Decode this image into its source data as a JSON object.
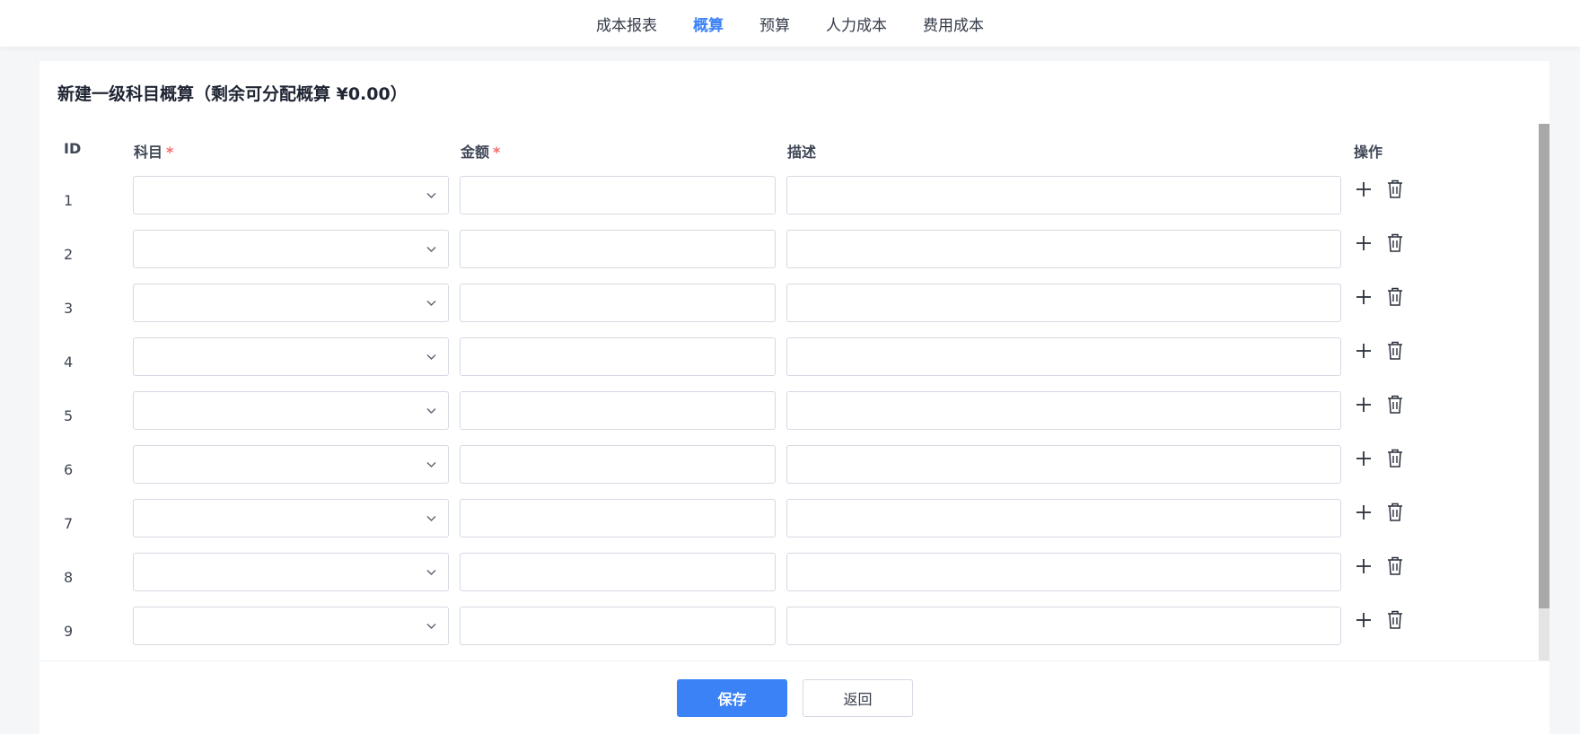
{
  "nav": {
    "tabs": [
      {
        "label": "成本报表",
        "active": false
      },
      {
        "label": "概算",
        "active": true
      },
      {
        "label": "预算",
        "active": false
      },
      {
        "label": "人力成本",
        "active": false
      },
      {
        "label": "费用成本",
        "active": false
      }
    ]
  },
  "form": {
    "title": "新建一级科目概算（剩余可分配概算 ¥0.00）",
    "columns": {
      "id": "ID",
      "subject": "科目",
      "amount": "金额",
      "description": "描述",
      "actions": "操作",
      "required_mark": "*"
    },
    "rows": [
      {
        "id": "1",
        "subject": "",
        "amount": "",
        "description": ""
      },
      {
        "id": "2",
        "subject": "",
        "amount": "",
        "description": ""
      },
      {
        "id": "3",
        "subject": "",
        "amount": "",
        "description": ""
      },
      {
        "id": "4",
        "subject": "",
        "amount": "",
        "description": ""
      },
      {
        "id": "5",
        "subject": "",
        "amount": "",
        "description": ""
      },
      {
        "id": "6",
        "subject": "",
        "amount": "",
        "description": ""
      },
      {
        "id": "7",
        "subject": "",
        "amount": "",
        "description": ""
      },
      {
        "id": "8",
        "subject": "",
        "amount": "",
        "description": ""
      },
      {
        "id": "9",
        "subject": "",
        "amount": "",
        "description": ""
      },
      {
        "id": "",
        "subject": "",
        "amount": "",
        "description": ""
      }
    ],
    "icons": {
      "add": "plus-icon",
      "delete": "trash-icon",
      "dropdown": "chevron-down-icon"
    }
  },
  "footer": {
    "save_label": "保存",
    "back_label": "返回"
  },
  "colors": {
    "accent": "#3b82f6",
    "required": "#f56c6c",
    "border": "#d5d9e2"
  }
}
